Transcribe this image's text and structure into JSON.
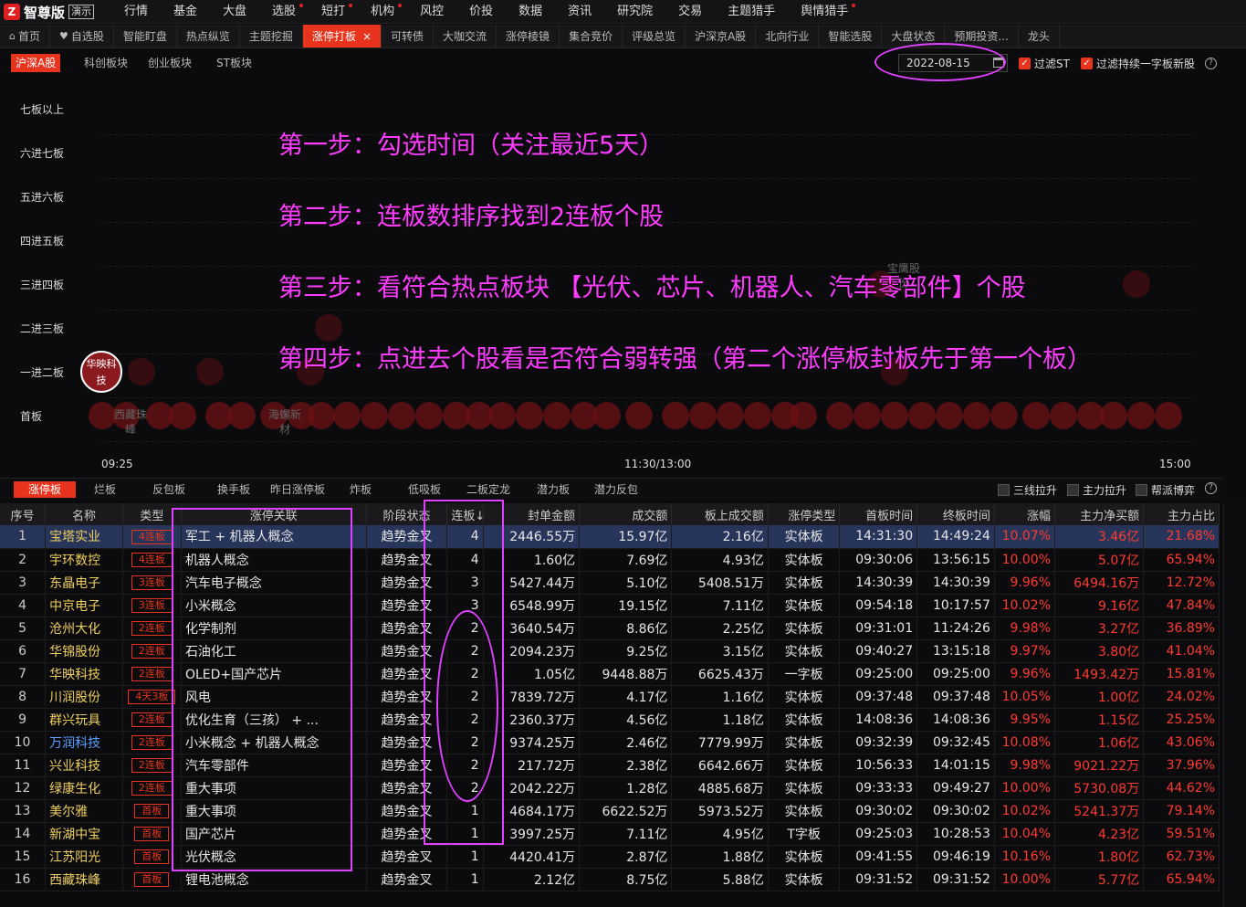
{
  "app": {
    "brand": "智尊版",
    "demo": "演示",
    "logo_glyph": "Z"
  },
  "menu": [
    {
      "label": "行情",
      "dot": false
    },
    {
      "label": "基金",
      "dot": false
    },
    {
      "label": "大盘",
      "dot": false
    },
    {
      "label": "选股",
      "dot": true
    },
    {
      "label": "短打",
      "dot": true
    },
    {
      "label": "机构",
      "dot": true
    },
    {
      "label": "风控",
      "dot": false
    },
    {
      "label": "价投",
      "dot": false
    },
    {
      "label": "数据",
      "dot": false
    },
    {
      "label": "资讯",
      "dot": false
    },
    {
      "label": "研究院",
      "dot": false
    },
    {
      "label": "交易",
      "dot": false
    },
    {
      "label": "主题猎手",
      "dot": false
    },
    {
      "label": "舆情猎手",
      "dot": true
    }
  ],
  "tabs": [
    {
      "label": "首页",
      "icon": "home-icon"
    },
    {
      "label": "自选股",
      "icon": "heart-icon"
    },
    {
      "label": "智能盯盘"
    },
    {
      "label": "热点纵览"
    },
    {
      "label": "主题挖掘"
    },
    {
      "label": "涨停打板",
      "active": true
    },
    {
      "label": "可转债"
    },
    {
      "label": "大咖交流"
    },
    {
      "label": "涨停棱镜"
    },
    {
      "label": "集合竞价"
    },
    {
      "label": "评级总览"
    },
    {
      "label": "沪深京A股"
    },
    {
      "label": "北向行业"
    },
    {
      "label": "智能选股"
    },
    {
      "label": "大盘状态"
    },
    {
      "label": "预期投资..."
    },
    {
      "label": "龙头"
    }
  ],
  "subtabs": [
    "沪深A股",
    "科创板块",
    "创业板块",
    "ST板块"
  ],
  "date": "2022-08-15",
  "filters": {
    "st": "过滤ST",
    "yizi": "过滤持续一字板新股"
  },
  "chart": {
    "rows": [
      "七板以上",
      "六进七板",
      "五进六板",
      "四进五板",
      "三进四板",
      "二进三板",
      "一进二板",
      "首板"
    ],
    "ticks": [
      "09:25",
      "11:30/13:00",
      "15:00"
    ],
    "highlight": "华映科技",
    "bubble_labels": [
      "西藏珠峰",
      "海螺新材",
      "宝鹰股份"
    ]
  },
  "annotations": [
    "第一步：勾选时间（关注最近5天）",
    "第二步：连板数排序找到2连板个股",
    "第三步：看符合热点板块 【光伏、芯片、机器人、汽车零部件】个股",
    "第四步：点进去个股看是否符合弱转强（第二个涨停板封板先于第一个板）"
  ],
  "bottom_tabs": [
    "涨停板",
    "烂板",
    "反包板",
    "换手板",
    "昨日涨停板",
    "炸板",
    "低吸板",
    "二板定龙",
    "潜力板",
    "潜力反包"
  ],
  "group_filters": [
    "三线拉升",
    "主力拉升",
    "帮派博弈"
  ],
  "columns": [
    "序号",
    "名称",
    "类型",
    "涨停关联",
    "阶段状态",
    "连板↓",
    "封单金额",
    "成交额",
    "板上成交额",
    "涨停类型",
    "首板时间",
    "终板时间",
    "涨幅",
    "主力净买额",
    "主力占比"
  ],
  "rows": [
    [
      "1",
      "宝塔实业",
      "4连板",
      "军工 + 机器人概念",
      "趋势金叉",
      "4",
      "2446.55万",
      "15.97亿",
      "2.16亿",
      "实体板",
      "14:31:30",
      "14:49:24",
      "10.07%",
      "3.46亿",
      "21.68%"
    ],
    [
      "2",
      "宇环数控",
      "4连板",
      "机器人概念",
      "趋势金叉",
      "4",
      "1.60亿",
      "7.69亿",
      "4.93亿",
      "实体板",
      "09:30:06",
      "13:56:15",
      "10.00%",
      "5.07亿",
      "65.94%"
    ],
    [
      "3",
      "东晶电子",
      "3连板",
      "汽车电子概念",
      "趋势金叉",
      "3",
      "5427.44万",
      "5.10亿",
      "5408.51万",
      "实体板",
      "14:30:39",
      "14:30:39",
      "9.96%",
      "6494.16万",
      "12.72%"
    ],
    [
      "4",
      "中京电子",
      "3连板",
      "小米概念",
      "趋势金叉",
      "3",
      "6548.99万",
      "19.15亿",
      "7.11亿",
      "实体板",
      "09:54:18",
      "10:17:57",
      "10.02%",
      "9.16亿",
      "47.84%"
    ],
    [
      "5",
      "沧州大化",
      "2连板",
      "化学制剂",
      "趋势金叉",
      "2",
      "3640.54万",
      "8.86亿",
      "2.25亿",
      "实体板",
      "09:31:01",
      "11:24:26",
      "9.98%",
      "3.27亿",
      "36.89%"
    ],
    [
      "6",
      "华锦股份",
      "2连板",
      "石油化工",
      "趋势金叉",
      "2",
      "2094.23万",
      "9.25亿",
      "3.15亿",
      "实体板",
      "09:40:27",
      "13:15:18",
      "9.97%",
      "3.80亿",
      "41.04%"
    ],
    [
      "7",
      "华映科技",
      "2连板",
      "OLED+国产芯片",
      "趋势金叉",
      "2",
      "1.05亿",
      "9448.88万",
      "6625.43万",
      "一字板",
      "09:25:00",
      "09:25:00",
      "9.96%",
      "1493.42万",
      "15.81%"
    ],
    [
      "8",
      "川润股份",
      "4天3板",
      "风电",
      "趋势金叉",
      "2",
      "7839.72万",
      "4.17亿",
      "1.16亿",
      "实体板",
      "09:37:48",
      "09:37:48",
      "10.05%",
      "1.00亿",
      "24.02%"
    ],
    [
      "9",
      "群兴玩具",
      "2连板",
      "优化生育（三孩） + ...",
      "趋势金叉",
      "2",
      "2360.37万",
      "4.56亿",
      "1.18亿",
      "实体板",
      "14:08:36",
      "14:08:36",
      "9.95%",
      "1.15亿",
      "25.25%"
    ],
    [
      "10",
      "万润科技",
      "2连板",
      "小米概念 + 机器人概念",
      "趋势金叉",
      "2",
      "9374.25万",
      "2.46亿",
      "7779.99万",
      "实体板",
      "09:32:39",
      "09:32:45",
      "10.08%",
      "1.06亿",
      "43.06%"
    ],
    [
      "11",
      "兴业科技",
      "2连板",
      "汽车零部件",
      "趋势金叉",
      "2",
      "217.72万",
      "2.38亿",
      "6642.66万",
      "实体板",
      "10:56:33",
      "14:01:15",
      "9.98%",
      "9021.22万",
      "37.96%"
    ],
    [
      "12",
      "绿康生化",
      "2连板",
      "重大事项",
      "趋势金叉",
      "2",
      "2042.22万",
      "1.28亿",
      "4885.68万",
      "实体板",
      "09:33:33",
      "09:49:27",
      "10.00%",
      "5730.08万",
      "44.62%"
    ],
    [
      "13",
      "美尔雅",
      "首板",
      "重大事项",
      "趋势金叉",
      "1",
      "4684.17万",
      "6622.52万",
      "5973.52万",
      "实体板",
      "09:30:02",
      "09:30:02",
      "10.02%",
      "5241.37万",
      "79.14%"
    ],
    [
      "14",
      "新湖中宝",
      "首板",
      "国产芯片",
      "趋势金叉",
      "1",
      "3997.25万",
      "7.11亿",
      "4.95亿",
      "T字板",
      "09:25:03",
      "10:28:53",
      "10.04%",
      "4.23亿",
      "59.51%"
    ],
    [
      "15",
      "江苏阳光",
      "首板",
      "光伏概念",
      "趋势金叉",
      "1",
      "4420.41万",
      "2.87亿",
      "1.88亿",
      "实体板",
      "09:41:55",
      "09:46:19",
      "10.16%",
      "1.80亿",
      "62.73%"
    ],
    [
      "16",
      "西藏珠峰",
      "首板",
      "锂电池概念",
      "趋势金叉",
      "1",
      "2.12亿",
      "8.75亿",
      "5.88亿",
      "实体板",
      "09:31:52",
      "09:31:52",
      "10.00%",
      "5.77亿",
      "65.94%"
    ]
  ],
  "colors": {
    "accent": "#e8341c",
    "annotation": "#ff3cff",
    "name_yellow": "#f0d060",
    "name_blue": "#5aa0ff",
    "up_red": "#ff3b30"
  }
}
